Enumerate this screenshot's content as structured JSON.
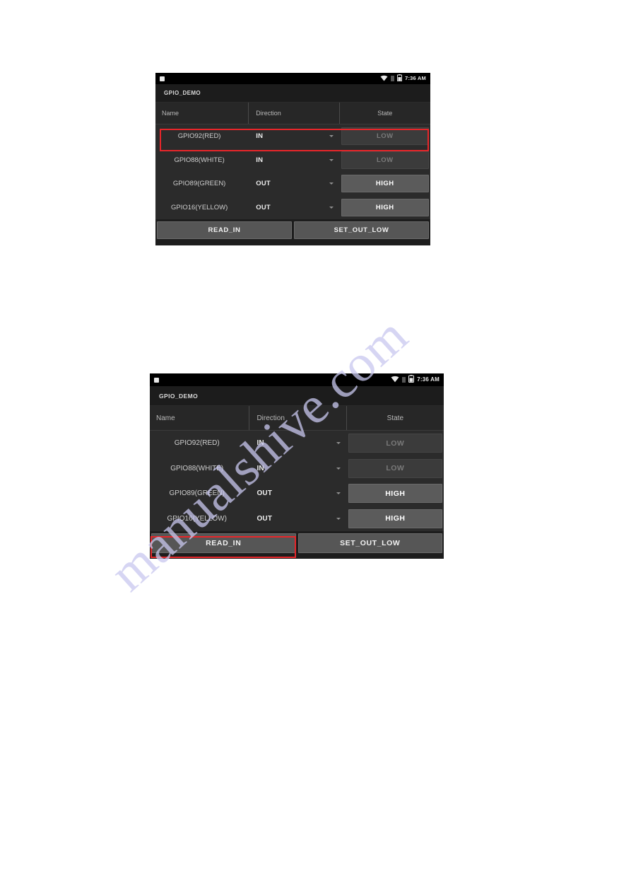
{
  "page": {
    "watermark": "manualshive.com",
    "background_color": "#ffffff"
  },
  "colors": {
    "device_background": "#1d1d1d",
    "statusbar_background": "#000000",
    "table_header_background": "#272727",
    "table_body_background": "#2b2b2b",
    "state_low_background": "#3b3b3b",
    "state_high_background": "#5b5b5b",
    "action_button_background": "#565656",
    "annotation_red": "#e8262a",
    "text_primary": "#ededed",
    "text_secondary": "#b9b9b9",
    "text_disabled": "#7a7a7a"
  },
  "screenshots": [
    {
      "id": "screenshot-1",
      "statusbar": {
        "notification_icon": "notification-square-icon",
        "wifi_icon": "wifi-icon",
        "sim_icon": "sim-card-icon",
        "battery_icon": "battery-icon",
        "time": "7:36 AM"
      },
      "appbar": {
        "title": "GPIO_DEMO"
      },
      "table": {
        "headers": {
          "name": "Name",
          "direction": "Direction",
          "state": "State"
        },
        "rows": [
          {
            "name": "GPIO92(RED)",
            "direction": "IN",
            "state": "LOW",
            "state_level": "low",
            "highlighted": true
          },
          {
            "name": "GPIO88(WHITE)",
            "direction": "IN",
            "state": "LOW",
            "state_level": "low",
            "highlighted": false
          },
          {
            "name": "GPIO89(GREEN)",
            "direction": "OUT",
            "state": "HIGH",
            "state_level": "high",
            "highlighted": false
          },
          {
            "name": "GPIO16(YELLOW)",
            "direction": "OUT",
            "state": "HIGH",
            "state_level": "high",
            "highlighted": false
          }
        ]
      },
      "actions": {
        "read_in": "READ_IN",
        "set_out_low": "SET_OUT_LOW"
      },
      "annotation": {
        "target": "row-gpio92-red",
        "shape": "rectangle",
        "color": "#e8262a"
      }
    },
    {
      "id": "screenshot-2",
      "statusbar": {
        "notification_icon": "notification-square-icon",
        "wifi_icon": "wifi-icon",
        "sim_icon": "sim-card-icon",
        "battery_icon": "battery-icon",
        "time": "7:36 AM"
      },
      "appbar": {
        "title": "GPIO_DEMO"
      },
      "table": {
        "headers": {
          "name": "Name",
          "direction": "Direction",
          "state": "State"
        },
        "rows": [
          {
            "name": "GPIO92(RED)",
            "direction": "IN",
            "state": "LOW",
            "state_level": "low",
            "highlighted": false
          },
          {
            "name": "GPIO88(WHITE)",
            "direction": "IN",
            "state": "LOW",
            "state_level": "low",
            "highlighted": false
          },
          {
            "name": "GPIO89(GREEN)",
            "direction": "OUT",
            "state": "HIGH",
            "state_level": "high",
            "highlighted": false
          },
          {
            "name": "GPIO16(YELLOW)",
            "direction": "OUT",
            "state": "HIGH",
            "state_level": "high",
            "highlighted": false
          }
        ]
      },
      "actions": {
        "read_in": "READ_IN",
        "set_out_low": "SET_OUT_LOW"
      },
      "annotation": {
        "target": "read-in-button",
        "shape": "rectangle",
        "color": "#e8262a"
      }
    }
  ]
}
